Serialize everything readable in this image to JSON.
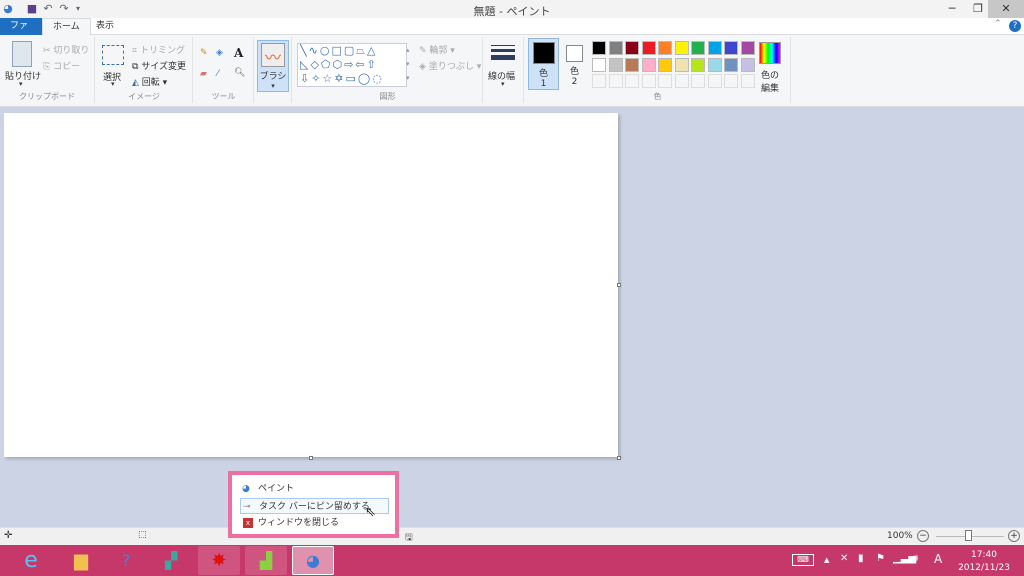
{
  "window": {
    "title": "無題 - ペイント",
    "minimize": "─",
    "restore": "❐",
    "close": "✕"
  },
  "tabs": [
    "ファイル",
    "ホーム",
    "表示"
  ],
  "ribbon": {
    "clipboard": {
      "paste": "貼り付け",
      "cut": "切り取り",
      "copy": "コピー",
      "label": "クリップボード"
    },
    "image": {
      "select": "選択",
      "crop": "トリミング",
      "resize": "サイズ変更",
      "rotate": "回転",
      "label": "イメージ"
    },
    "tools": {
      "label": "ツール"
    },
    "brush": {
      "label": "ブラシ"
    },
    "shapes": {
      "outline": "輪郭",
      "fill": "塗りつぶし",
      "label": "図形"
    },
    "size": {
      "label": "線の幅"
    },
    "colors": {
      "color1": "色",
      "color1_num": "1",
      "color2": "色",
      "color2_num": "2",
      "edit1": "色の",
      "edit2": "編集",
      "label": "色",
      "row1": [
        "#000000",
        "#7f7f7f",
        "#880015",
        "#ed1c24",
        "#ff7f27",
        "#fff200",
        "#22b14c",
        "#00a2e8",
        "#3f48cc",
        "#a349a4"
      ],
      "row2": [
        "#ffffff",
        "#c3c3c3",
        "#b97a57",
        "#ffaec9",
        "#ffc90e",
        "#efe4b0",
        "#b5e61d",
        "#99d9ea",
        "#7092be",
        "#c8bfe7"
      ]
    }
  },
  "status": {
    "zoom": "100%"
  },
  "popup": {
    "items": [
      "ペイント",
      "タスク バーにピン留めする",
      "ウィンドウを閉じる"
    ]
  },
  "tray": {
    "time": "17:40",
    "date": "2012/11/23",
    "ime": "A"
  },
  "colors": {
    "taskbar": "#c7386a",
    "popup_border": "#ee6fa0",
    "file_tab": "#1e6fc1"
  }
}
